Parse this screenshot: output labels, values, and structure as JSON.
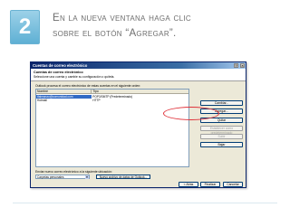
{
  "slide": {
    "step_number": "2",
    "heading_line1": "En la nueva ventana haga clic",
    "heading_line2": "sobre el botón “Agregar”."
  },
  "dialog": {
    "title": "Cuentas de correo electrónico",
    "header_title": "Cuentas de correo electrónico",
    "header_subtitle": "Seleccione una cuenta y cambie su configuración o quítela.",
    "intro_text": "Outlook procesa el correo electrónico de estas cuentas en el siguiente orden:",
    "columns": [
      "Nombre",
      "Tipo"
    ],
    "accounts": [
      {
        "name": "tfalmanzo@comunidad.com",
        "type": "POP3/SMTP (Predeterminado)"
      },
      {
        "name": "Hotmail",
        "type": "HTTP"
      }
    ],
    "buttons": {
      "change": "Cambiar...",
      "add": "Agregar...",
      "remove": "Quitar",
      "set_default": "Establecer como predeterminado",
      "move_up": "Subir",
      "move_down": "Bajar"
    },
    "deliver_label": "Enviar nuevo correo electrónico a la siguiente ubicación:",
    "deliver_folder": "Carpetas personales",
    "new_data_file": "Nuevo archivo de datos de Outlook...",
    "previous": "< Atrás",
    "finish": "Finalizar",
    "cancel": "Cancelar"
  },
  "colors": {
    "badge": "#5fb0d4",
    "heading": "#6e6e6e",
    "titlebar": "#0a246a",
    "highlight": "#e0323a"
  }
}
